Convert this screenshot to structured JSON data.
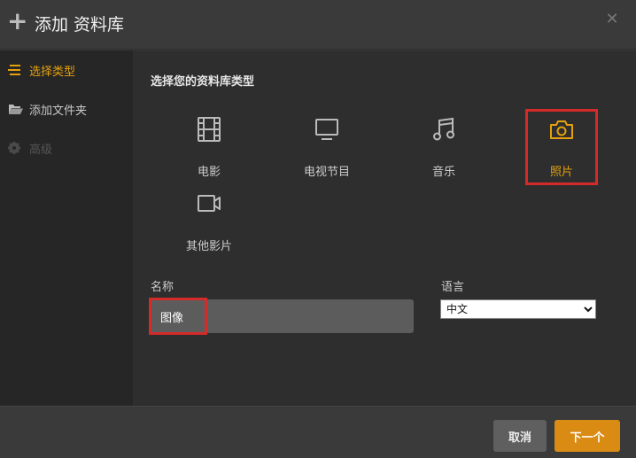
{
  "header": {
    "title": "添加 资料库",
    "add_icon": "plus-icon",
    "close_icon": "close-icon"
  },
  "sidebar": {
    "items": [
      {
        "label": "选择类型",
        "icon": "list-icon",
        "state": "active"
      },
      {
        "label": "添加文件夹",
        "icon": "folder-icon",
        "state": "normal"
      },
      {
        "label": "高级",
        "icon": "gear-icon",
        "state": "disabled"
      }
    ]
  },
  "main": {
    "prompt": "选择您的资料库类型",
    "types": [
      {
        "label": "电影",
        "icon": "film-icon"
      },
      {
        "label": "电视节目",
        "icon": "tv-icon"
      },
      {
        "label": "音乐",
        "icon": "music-icon"
      },
      {
        "label": "照片",
        "icon": "camera-icon",
        "selected": true
      },
      {
        "label": "其他影片",
        "icon": "video-camera-icon"
      }
    ],
    "name_label": "名称",
    "name_value": "图像",
    "language_label": "语言",
    "language_value": "中文"
  },
  "footer": {
    "cancel_label": "取消",
    "next_label": "下一个"
  },
  "colors": {
    "accent": "#e5a00d",
    "highlight": "#d42a2a",
    "next_button": "#d98b14"
  }
}
